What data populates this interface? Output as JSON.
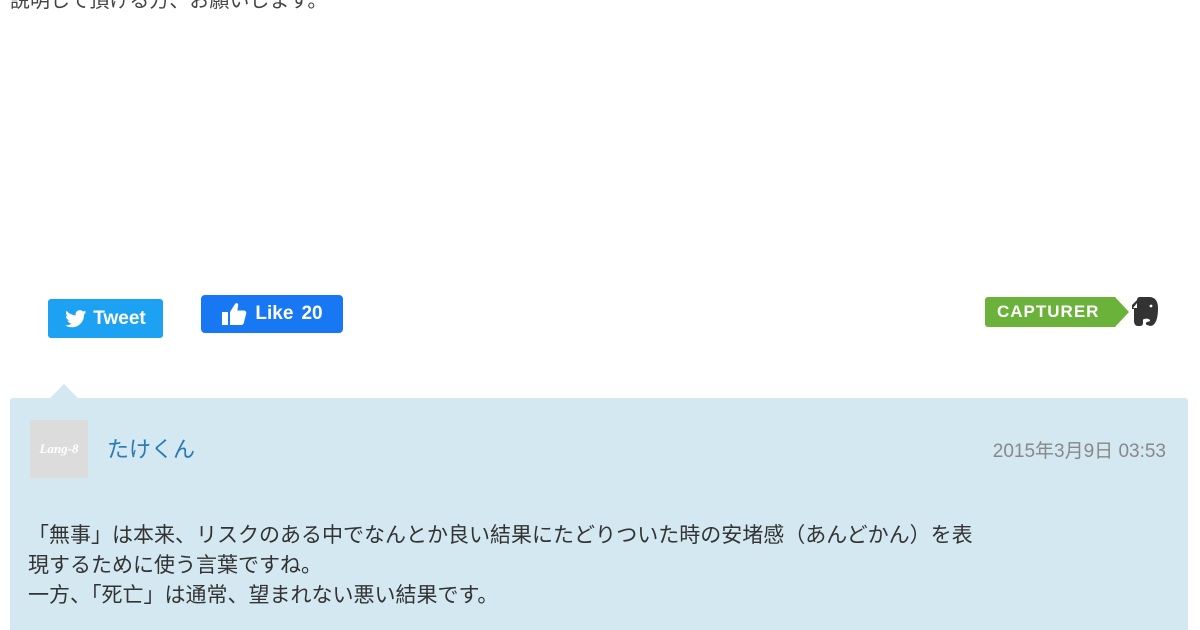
{
  "post": {
    "partial_text": "説明して頂ける方、お願いします。"
  },
  "share": {
    "tweet_label": "Tweet",
    "like_label": "Like",
    "like_count": "20",
    "capturer_label": "CAPTURER"
  },
  "comment": {
    "avatar_text": "Lang-8",
    "username": "たけくん",
    "timestamp": "2015年3月9日 03:53",
    "lines": [
      "「無事」は本来、リスクのある中でなんとか良い結果にたどりついた時の安堵感（あんどかん）を表",
      "現するために使う言葉ですね。",
      "一方、「死亡」は通常、望まれない悪い結果です。"
    ]
  },
  "colors": {
    "tweet": "#1da1f2",
    "like": "#1877f2",
    "capturer": "#6bb23b",
    "comment_bg": "#d3e8f0",
    "username": "#2a7ab5"
  },
  "icons": {
    "tweet": "twitter-bird-icon",
    "like": "thumbs-up-icon",
    "evernote": "evernote-elephant-icon"
  }
}
